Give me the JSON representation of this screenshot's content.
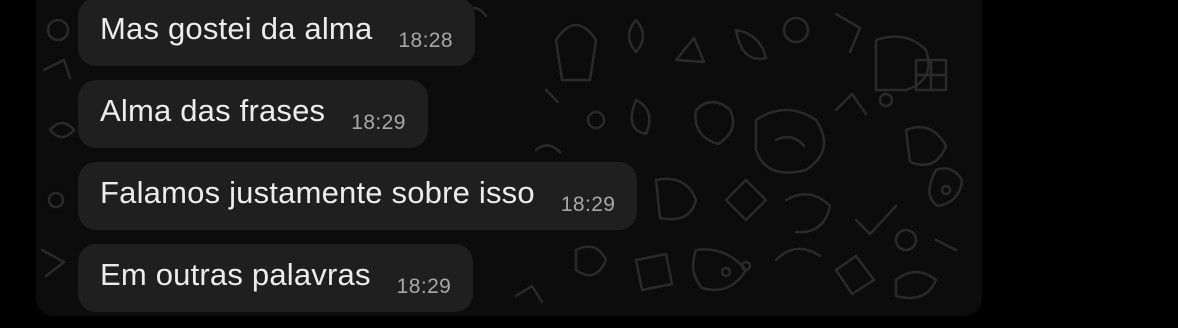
{
  "chat": {
    "messages": [
      {
        "text": "Mas gostei da alma",
        "time": "18:28"
      },
      {
        "text": "Alma das frases",
        "time": "18:29"
      },
      {
        "text": "Falamos justamente sobre isso",
        "time": "18:29"
      },
      {
        "text": "Em outras palavras",
        "time": "18:29"
      }
    ]
  },
  "colors": {
    "page_background": "#000000",
    "chat_background": "#0c0c0c",
    "bubble_background": "#1f1f1f",
    "message_text": "#ececec",
    "timestamp_text": "#a7a7a7"
  }
}
